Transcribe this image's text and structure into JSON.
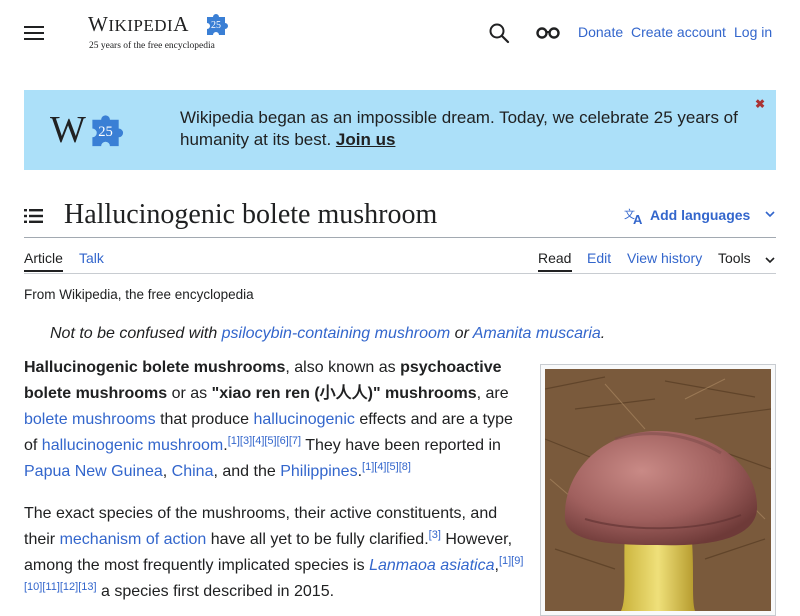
{
  "header": {
    "menu_icon": "hamburger-menu-icon",
    "logo_wordmark_big1": "W",
    "logo_wordmark_small1": "IKIPEDI",
    "logo_wordmark_big2": "A",
    "logo_badge": "25",
    "tagline": "25 years of the free encyclopedia",
    "search_icon": "search-icon",
    "glasses_icon": "glasses-icon",
    "donate": "Donate",
    "create_account": "Create account",
    "log_in": "Log in"
  },
  "banner": {
    "logo_W": "W",
    "logo_badge": "25",
    "text": "Wikipedia began as an impossible dream. Today, we celebrate 25 years of humanity at its best. ",
    "join": "Join us",
    "close_icon": "close-icon",
    "background": "#ace0f9"
  },
  "article": {
    "title": "Hallucinogenic bolete mushroom",
    "add_languages": "Add languages",
    "tabs": {
      "article": "Article",
      "talk": "Talk",
      "read": "Read",
      "edit": "Edit",
      "view_history": "View history",
      "tools": "Tools"
    },
    "from": "From Wikipedia, the free encyclopedia",
    "hatnote": {
      "prefix": "Not to be confused with ",
      "link1": "psilocybin-containing mushroom",
      "mid": " or ",
      "link2": "Amanita muscaria",
      "suffix": "."
    },
    "p1": {
      "b1": "Hallucinogenic bolete mushrooms",
      "t1": ", also known as ",
      "b2": "psychoactive bolete mushrooms",
      "t2": " or as ",
      "b3": "\"xiao ren ren (小人人)\" mushrooms",
      "t3": ", are ",
      "l1": "bolete mushrooms",
      "t4": " that produce ",
      "l2": "hallucinogenic",
      "t5": " effects and are a type of ",
      "l3": "hallucinogenic mushroom",
      "t6": ".",
      "refs1": "[1][3][4][5][6][7]",
      "t7": " They have been reported in ",
      "l4": "Papua New Guinea",
      "t8": ", ",
      "l5": "China",
      "t9": ", and the ",
      "l6": "Philippines",
      "t10": ".",
      "refs2": "[1][4][5][8]"
    },
    "p2": {
      "t1": "The exact species of the mushrooms, their active constituents, and their ",
      "l1": "mechanism of action",
      "t2": " have all yet to be fully clarified.",
      "refs1": "[3]",
      "t3": " However, among the most frequently implicated species is ",
      "l2": "Lanmaoa asiatica",
      "t4": ",",
      "refs2": "[1][9][10][11][12][13]",
      "t5": " a species first described in 2015."
    },
    "image_desc_icon": "mushroom-photo"
  }
}
